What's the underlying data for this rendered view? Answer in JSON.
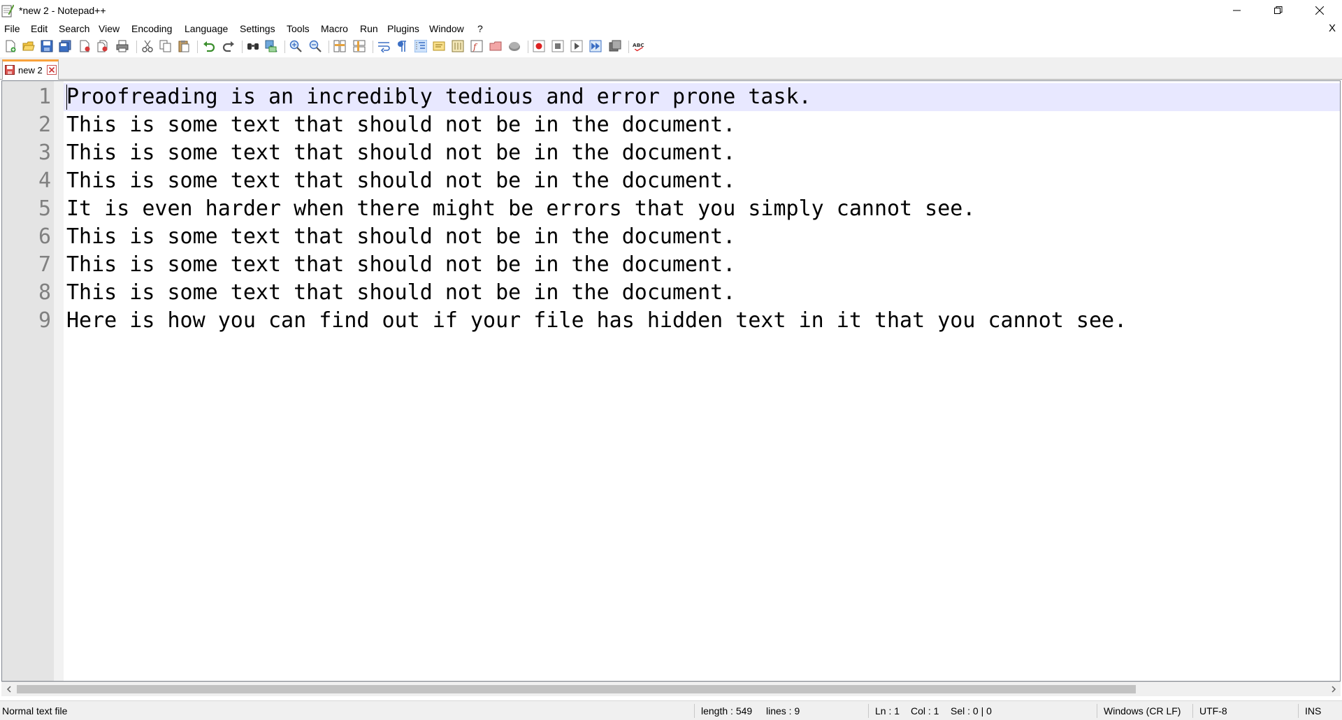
{
  "window": {
    "title": "*new 2 - Notepad++",
    "controls": {
      "minimize": "—",
      "maximize": "❐",
      "close": "✕"
    }
  },
  "menu": {
    "items": [
      "File",
      "Edit",
      "Search",
      "View",
      "Encoding",
      "Language",
      "Settings",
      "Tools",
      "Macro",
      "Run",
      "Plugins",
      "Window",
      "?"
    ],
    "close_doc": "X"
  },
  "tabs": [
    {
      "label": "new 2",
      "unsaved": true
    }
  ],
  "editor": {
    "current_line": 1,
    "lines": [
      {
        "num": "1",
        "text": "Proofreading is an incredibly tedious and error prone task."
      },
      {
        "num": "2",
        "text": "This is some text that should not be in the document."
      },
      {
        "num": "3",
        "text": "This is some text that should not be in the document."
      },
      {
        "num": "4",
        "text": "This is some text that should not be in the document."
      },
      {
        "num": "5",
        "text": "It is even harder when there might be errors that you simply cannot see."
      },
      {
        "num": "6",
        "text": "This is some text that should not be in the document."
      },
      {
        "num": "7",
        "text": "This is some text that should not be in the document."
      },
      {
        "num": "8",
        "text": "This is some text that should not be in the document."
      },
      {
        "num": "9",
        "text": "Here is how you can find out if your file has hidden text in it that you cannot see."
      }
    ]
  },
  "status": {
    "file_type": "Normal text file",
    "length": "length : 549",
    "lines": "lines : 9",
    "ln": "Ln : 1",
    "col": "Col : 1",
    "sel": "Sel : 0 | 0",
    "eol": "Windows (CR LF)",
    "encoding": "UTF-8",
    "mode": "INS"
  },
  "colors": {
    "accent_tab": "#f9a23b",
    "current_line": "#e8e8ff",
    "gutter": "#e4e4e4",
    "line_number": "#808080"
  }
}
